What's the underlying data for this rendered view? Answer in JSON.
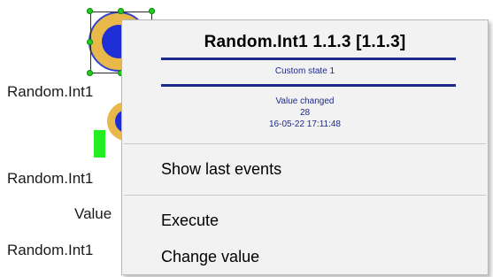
{
  "background": {
    "object_labels": [
      "Random.Int1",
      "Random.Int1",
      "Value",
      "Random.Int1"
    ]
  },
  "context_menu": {
    "header": {
      "title": "Random.Int1 1.1.3 [1.1.3]",
      "state": "Custom state 1",
      "event_name": "Value changed",
      "event_value": "28",
      "event_time": "16-05-22 17:11:48"
    },
    "items": [
      {
        "label": "Show last events"
      },
      {
        "label": "Execute"
      },
      {
        "label": "Change value"
      }
    ]
  },
  "colors": {
    "accent_blue": "#1c2a8c",
    "icon_ring": "#e8b84a",
    "icon_core": "#1f2fd6",
    "status_green": "#22ee22",
    "handle_green": "#22cc22"
  }
}
